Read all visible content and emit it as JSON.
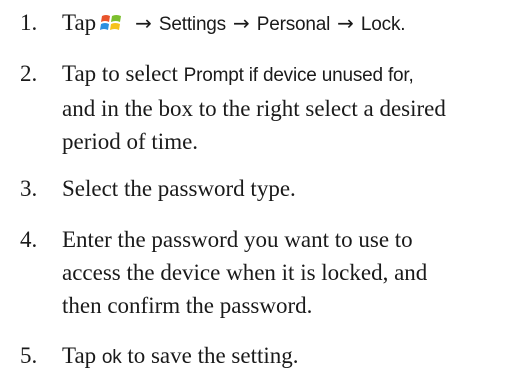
{
  "steps": [
    {
      "number": "1.",
      "text": "Tap",
      "icon": "windows-start-icon",
      "path": [
        "Settings",
        "Personal",
        "Lock"
      ],
      "end": "."
    },
    {
      "number": "2.",
      "pre": "Tap to select",
      "bold": "Prompt if device unused for,",
      "lines": [
        "and in the box to the right select a desired",
        "period of time."
      ]
    },
    {
      "number": "3.",
      "text": "Select the password type."
    },
    {
      "number": "4.",
      "lines": [
        "Enter the password you want to use to",
        "access the device when it is locked, and",
        "then confirm the password."
      ]
    },
    {
      "number": "5.",
      "pre": "Tap",
      "ui": "ok",
      "post": "to save the setting."
    }
  ],
  "arrow_glyph": "→",
  "colors": {
    "text": "#1a1a1a",
    "logo_red": "#e8542c",
    "logo_green": "#7cbf2e",
    "logo_blue": "#2d8fe0",
    "logo_yellow": "#f5c21b"
  }
}
